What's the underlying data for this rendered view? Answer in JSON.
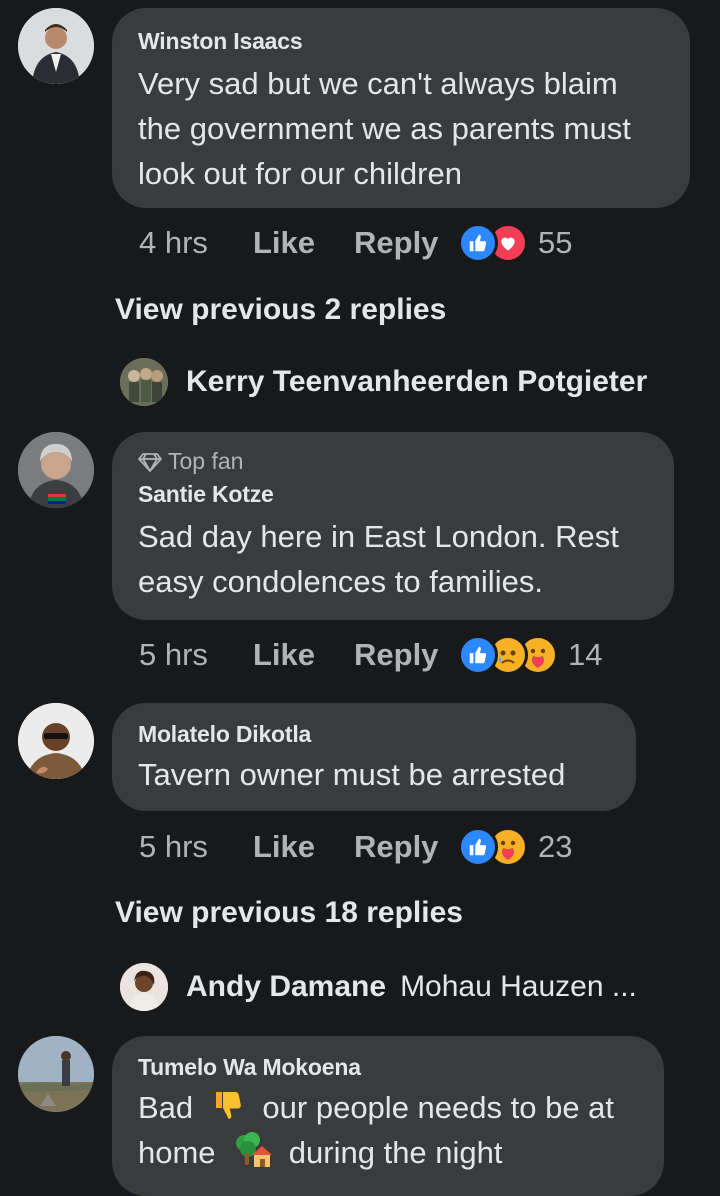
{
  "colors": {
    "background": "#18191a",
    "bubble": "#3a3b3c",
    "like_blue": "#2d88ff",
    "love_red": "#f33e58",
    "text_secondary": "#b0b3b8"
  },
  "comments": [
    {
      "author": "Winston Isaacs",
      "text": "Very sad but we can't always blaim the government we as parents must look out for our children",
      "time": "4 hrs",
      "like": "Like",
      "reply": "Reply",
      "reactions": [
        "like",
        "love"
      ],
      "count": "55"
    },
    {
      "badge": "Top fan",
      "author": "Santie Kotze",
      "text": "Sad day here in East London. Rest easy condolences to families.",
      "time": "5 hrs",
      "like": "Like",
      "reply": "Reply",
      "reactions": [
        "like",
        "cry",
        "care"
      ],
      "count": "14"
    },
    {
      "author": "Molatelo Dikotla",
      "text": "Tavern owner must be arrested",
      "time": "5 hrs",
      "like": "Like",
      "reply": "Reply",
      "reactions": [
        "like",
        "care"
      ],
      "count": "23"
    },
    {
      "author": "Tumelo Wa Mokoena",
      "text_parts": [
        "Bad",
        "our people needs to be at",
        "home",
        "during the night"
      ],
      "emojis": [
        "thumbs-down",
        "tree-house"
      ]
    }
  ],
  "view_previous": [
    "View previous 2 replies",
    "View previous 18 replies"
  ],
  "reply_previews": [
    {
      "name": "Kerry Teenvanheerden Potgieter",
      "snippet": ""
    },
    {
      "name": "Andy Damane",
      "snippet": "Mohau Hauzen ..."
    }
  ]
}
